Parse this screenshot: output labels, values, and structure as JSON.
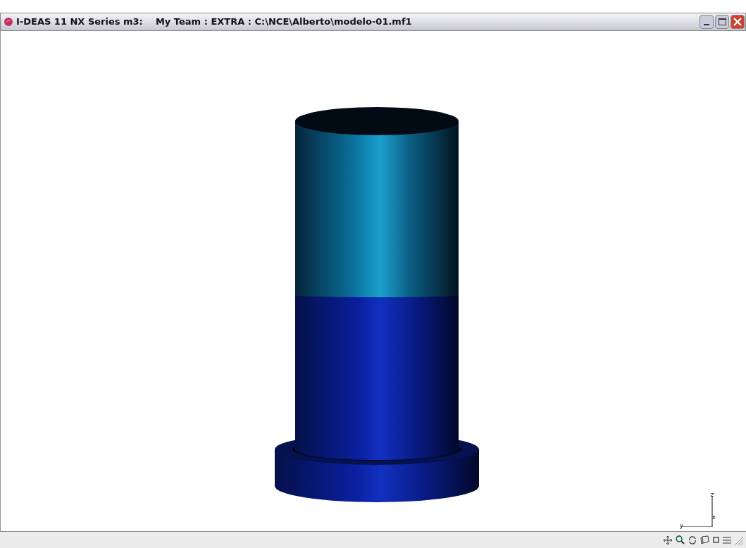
{
  "window": {
    "title": "I-DEAS 11 NX Series m3:    My Team : EXTRA : C:\\NCE\\Alberto\\modelo-01.mf1"
  },
  "triad": {
    "labels": [
      "z",
      "x",
      "y"
    ]
  }
}
